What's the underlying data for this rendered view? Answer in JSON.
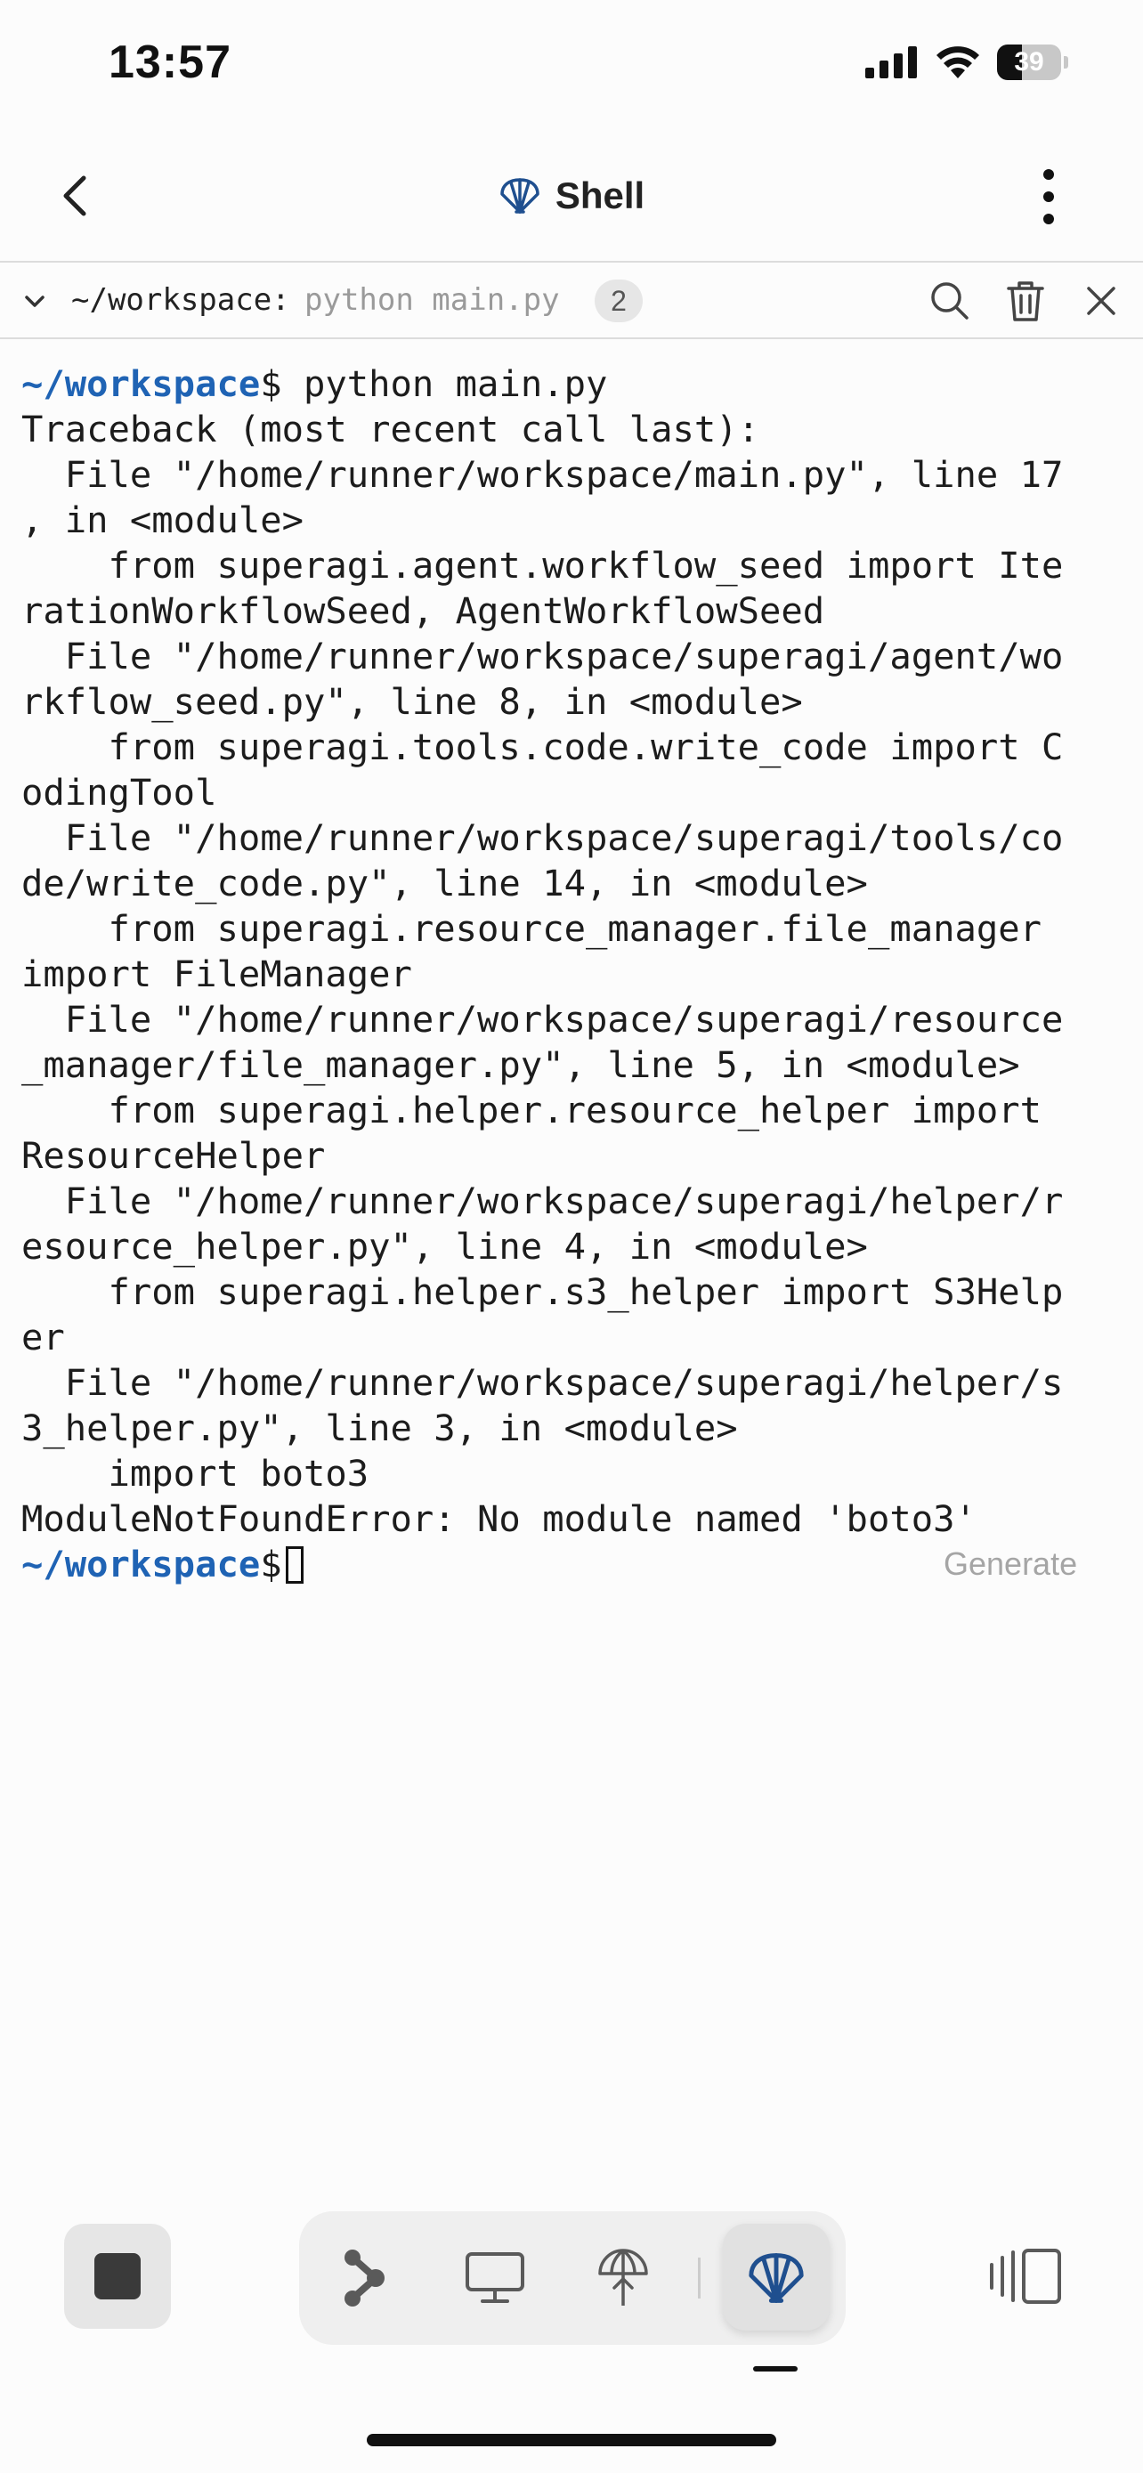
{
  "status_bar": {
    "time": "13:57",
    "battery_percent": 39
  },
  "header": {
    "title": "Shell",
    "title_icon": "shell-icon",
    "back_icon": "chevron-left-icon",
    "menu_icon": "more-vertical-icon"
  },
  "command_bar": {
    "path": "~/workspace:",
    "command": "python main.py",
    "count": "2",
    "icons": [
      "chevron-down-icon",
      "search-icon",
      "trash-icon",
      "close-icon"
    ]
  },
  "terminal": {
    "prompt_path": "~/workspace",
    "prompt_symbol": "$",
    "command": " python main.py",
    "output_lines": [
      "Traceback (most recent call last):",
      "  File \"/home/runner/workspace/main.py\", line 17",
      ", in <module>",
      "    from superagi.agent.workflow_seed import Ite",
      "rationWorkflowSeed, AgentWorkflowSeed",
      "  File \"/home/runner/workspace/superagi/agent/wo",
      "rkflow_seed.py\", line 8, in <module>",
      "    from superagi.tools.code.write_code import C",
      "odingTool",
      "  File \"/home/runner/workspace/superagi/tools/co",
      "de/write_code.py\", line 14, in <module>",
      "    from superagi.resource_manager.file_manager ",
      "import FileManager",
      "  File \"/home/runner/workspace/superagi/resource",
      "_manager/file_manager.py\", line 5, in <module>",
      "    from superagi.helper.resource_helper import ",
      "ResourceHelper",
      "  File \"/home/runner/workspace/superagi/helper/r",
      "esource_helper.py\", line 4, in <module>",
      "    from superagi.helper.s3_helper import S3Help",
      "er",
      "  File \"/home/runner/workspace/superagi/helper/s",
      "3_helper.py\", line 3, in <module>",
      "    import boto3",
      "ModuleNotFoundError: No module named 'boto3'"
    ],
    "generate_label": "Generate"
  },
  "toolbar": {
    "stop_icon": "stop-icon",
    "dock_icons": [
      "git-branch-icon",
      "monitor-icon",
      "deploy-icon",
      "shell-icon"
    ],
    "panels_icon": "panels-icon"
  },
  "colors": {
    "prompt": "#1f63b4",
    "shell_icon": "#1f4f8f",
    "background": "#fcfcfc"
  }
}
